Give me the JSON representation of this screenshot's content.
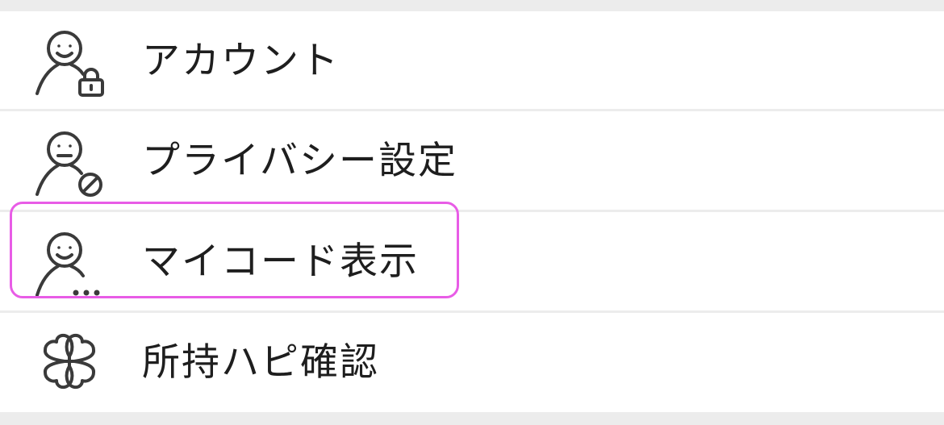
{
  "menu": {
    "items": [
      {
        "id": "account",
        "label": "アカウント",
        "icon": "user-lock-icon"
      },
      {
        "id": "privacy",
        "label": "プライバシー設定",
        "icon": "user-block-icon"
      },
      {
        "id": "mycode",
        "label": "マイコード表示",
        "icon": "user-more-icon"
      },
      {
        "id": "hapi",
        "label": "所持ハピ確認",
        "icon": "clover-icon"
      }
    ],
    "highlighted_item": "mycode"
  },
  "colors": {
    "background": "#ececec",
    "row": "#ffffff",
    "text": "#1e1e1e",
    "icon": "#3a3a3a",
    "highlight": "#e85ce6"
  }
}
